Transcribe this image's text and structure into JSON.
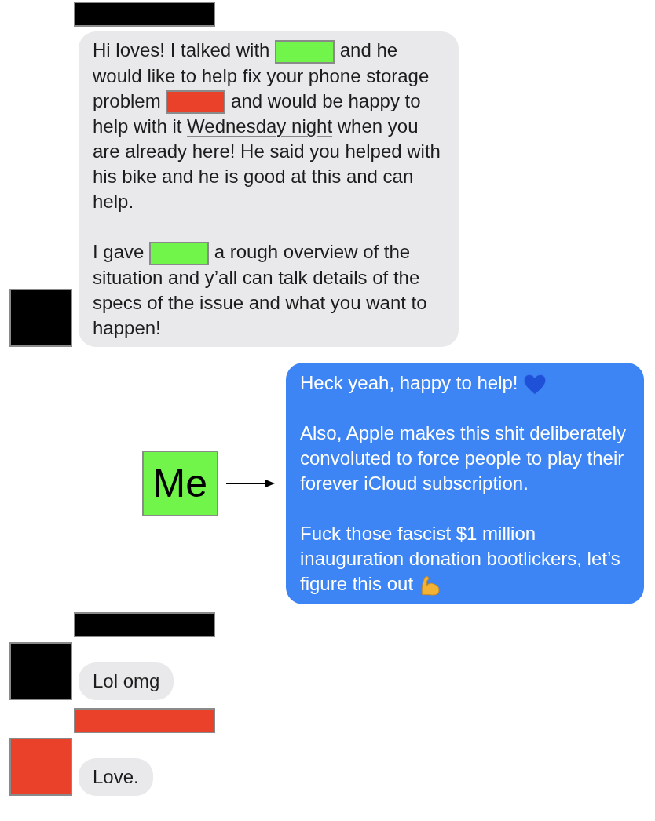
{
  "messages": [
    {
      "kind": "incoming",
      "sender": {
        "color": "#000000"
      },
      "avatar": {
        "color": "#000000"
      },
      "paragraphs": [
        [
          {
            "kind": "text",
            "text": "Hi loves! I talked with "
          },
          {
            "kind": "redaction",
            "color": "#72f54a"
          },
          {
            "kind": "text",
            "text": " and he would like to help fix your phone storage problem "
          },
          {
            "kind": "redaction",
            "color": "#e9412a"
          },
          {
            "kind": "text",
            "text": " and would be happy to help with it "
          },
          {
            "kind": "link",
            "text": "Wednesday night"
          },
          {
            "kind": "text",
            "text": " when you are already here! He said you helped with his bike and he is good at this  and can help."
          }
        ],
        [
          {
            "kind": "text",
            "text": "I gave "
          },
          {
            "kind": "redaction",
            "color": "#72f54a"
          },
          {
            "kind": "text",
            "text": " a rough overview of the situation and y’all can talk details of the specs of the issue and what you want to happen!"
          }
        ]
      ]
    },
    {
      "kind": "outgoing",
      "annotation": {
        "label": "Me",
        "color": "#72f54a"
      },
      "paragraphs": [
        [
          {
            "kind": "text",
            "text": "Heck yeah, happy to help! "
          },
          {
            "kind": "heart"
          }
        ],
        [
          {
            "kind": "text",
            "text": "Also, Apple makes this shit deliberately convoluted to force people to play their forever iCloud subscription."
          }
        ],
        [
          {
            "kind": "text",
            "text": "Fuck those fascist $1 million inauguration donation bootlickers, let’s figure this out "
          },
          {
            "kind": "biceps"
          }
        ]
      ]
    },
    {
      "kind": "incoming",
      "sender": {
        "color": "#000000"
      },
      "avatar": {
        "color": "#000000"
      },
      "paragraphs": [
        [
          {
            "kind": "text",
            "text": "Lol omg"
          }
        ]
      ]
    },
    {
      "kind": "incoming",
      "sender": {
        "color": "#e9412a"
      },
      "avatar": {
        "color": "#e9412a"
      },
      "paragraphs": [
        [
          {
            "kind": "text",
            "text": "Love."
          }
        ]
      ]
    }
  ]
}
